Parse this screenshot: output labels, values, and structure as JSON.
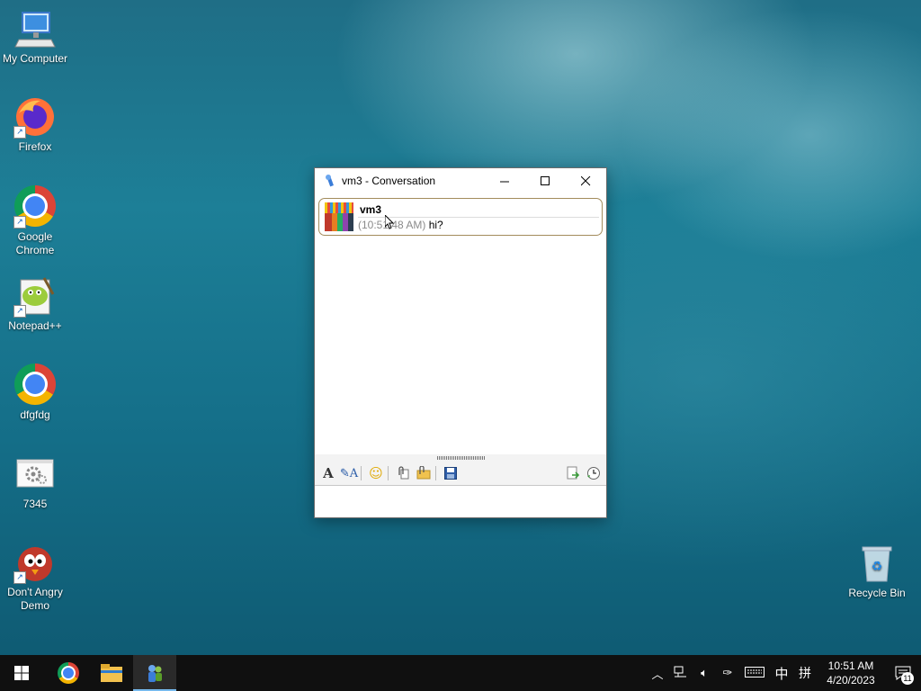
{
  "desktop": {
    "icons": [
      {
        "label": "My Computer"
      },
      {
        "label": "Firefox"
      },
      {
        "label": "Google Chrome"
      },
      {
        "label": "Notepad++"
      },
      {
        "label": "dfgfdg"
      },
      {
        "label": "7345"
      },
      {
        "label": "Don't Angry Demo"
      },
      {
        "label": "Recycle Bin"
      }
    ]
  },
  "window": {
    "title": "vm3 - Conversation",
    "message": {
      "sender": "vm3",
      "time": "(10:51:48 AM)",
      "text": "hi?"
    }
  },
  "taskbar": {
    "tray": {
      "ime": "中",
      "ime_mode": "拼",
      "time": "10:51 AM",
      "date": "4/20/2023",
      "notification_count": "11"
    }
  }
}
